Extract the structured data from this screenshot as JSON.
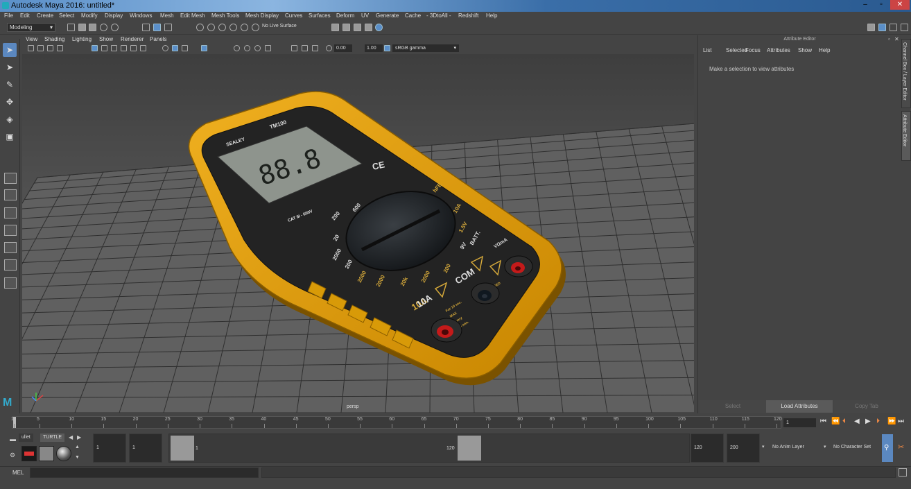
{
  "window": {
    "title": "Autodesk Maya 2016: untitled*"
  },
  "menubar": {
    "items": [
      "File",
      "Edit",
      "Create",
      "Select",
      "Modify",
      "Display",
      "Windows",
      "Mesh",
      "Edit Mesh",
      "Mesh Tools",
      "Mesh Display",
      "Curves",
      "Surfaces",
      "Deform",
      "UV",
      "Generate",
      "Cache",
      "- 3DtoAll -",
      "Redshift",
      "Help"
    ]
  },
  "shelf": {
    "mode": "Modeling",
    "live_surface": "No Live Surface"
  },
  "panel": {
    "menu": [
      "View",
      "Shading",
      "Lighting",
      "Show",
      "Renderer",
      "Panels"
    ],
    "exposure": "0.00",
    "gamma": "1.00",
    "color_space": "sRGB gamma",
    "camera": "persp"
  },
  "model": {
    "brand": "SEALEY",
    "model_label": "TM100",
    "display_digits": "88.8",
    "cat_label": "CAT III - 600V",
    "ce_mark": "CE",
    "dial_labels": [
      "600",
      "200",
      "2000",
      "200",
      "20",
      "2000",
      "200",
      "20",
      "2000",
      "200",
      "20",
      "2",
      "200",
      "2000",
      "200k",
      "20k",
      "2000",
      "200",
      "10A",
      "hFE",
      "BATT.",
      "1.5V",
      "9V",
      "10A"
    ],
    "port_labels": {
      "com": "COM",
      "high_current": "10A",
      "volt_ohm": "VΩmA"
    },
    "warning_text": [
      "For 10 sec.",
      "MAX",
      "every",
      "15 min.",
      "FUSED"
    ]
  },
  "attribute_editor": {
    "title": "Attribute Editor",
    "menu": [
      "List",
      "Selected",
      "Focus",
      "Attributes",
      "Show",
      "Help"
    ],
    "hint": "Make a selection to view attributes",
    "buttons": {
      "select": "Select",
      "load": "Load Attributes",
      "copy": "Copy Tab"
    }
  },
  "sidetabs": {
    "channel_box": "Channel Box / Layer Editor",
    "attribute_editor": "Attribute Editor"
  },
  "timeline": {
    "ticks": [
      "1",
      "5",
      "10",
      "15",
      "20",
      "25",
      "30",
      "35",
      "40",
      "45",
      "50",
      "55",
      "60",
      "65",
      "70",
      "75",
      "80",
      "85",
      "90",
      "95",
      "100",
      "105",
      "110",
      "115",
      "120"
    ],
    "current_frame": "1"
  },
  "range": {
    "start_field": "1",
    "start_inner": "1",
    "range_start": "1",
    "range_end": "120",
    "end_field": "120",
    "end_outer": "200",
    "anim_layer": "No Anim Layer",
    "char_set": "No Character Set",
    "shelf_tabs": [
      "ullet",
      "TURTLE"
    ]
  },
  "cmdline": {
    "label": "MEL"
  },
  "colors": {
    "body": "#e5a200",
    "panel_black": "#222222",
    "port_red": "#c41a1a",
    "accent": "#5b88c0"
  }
}
